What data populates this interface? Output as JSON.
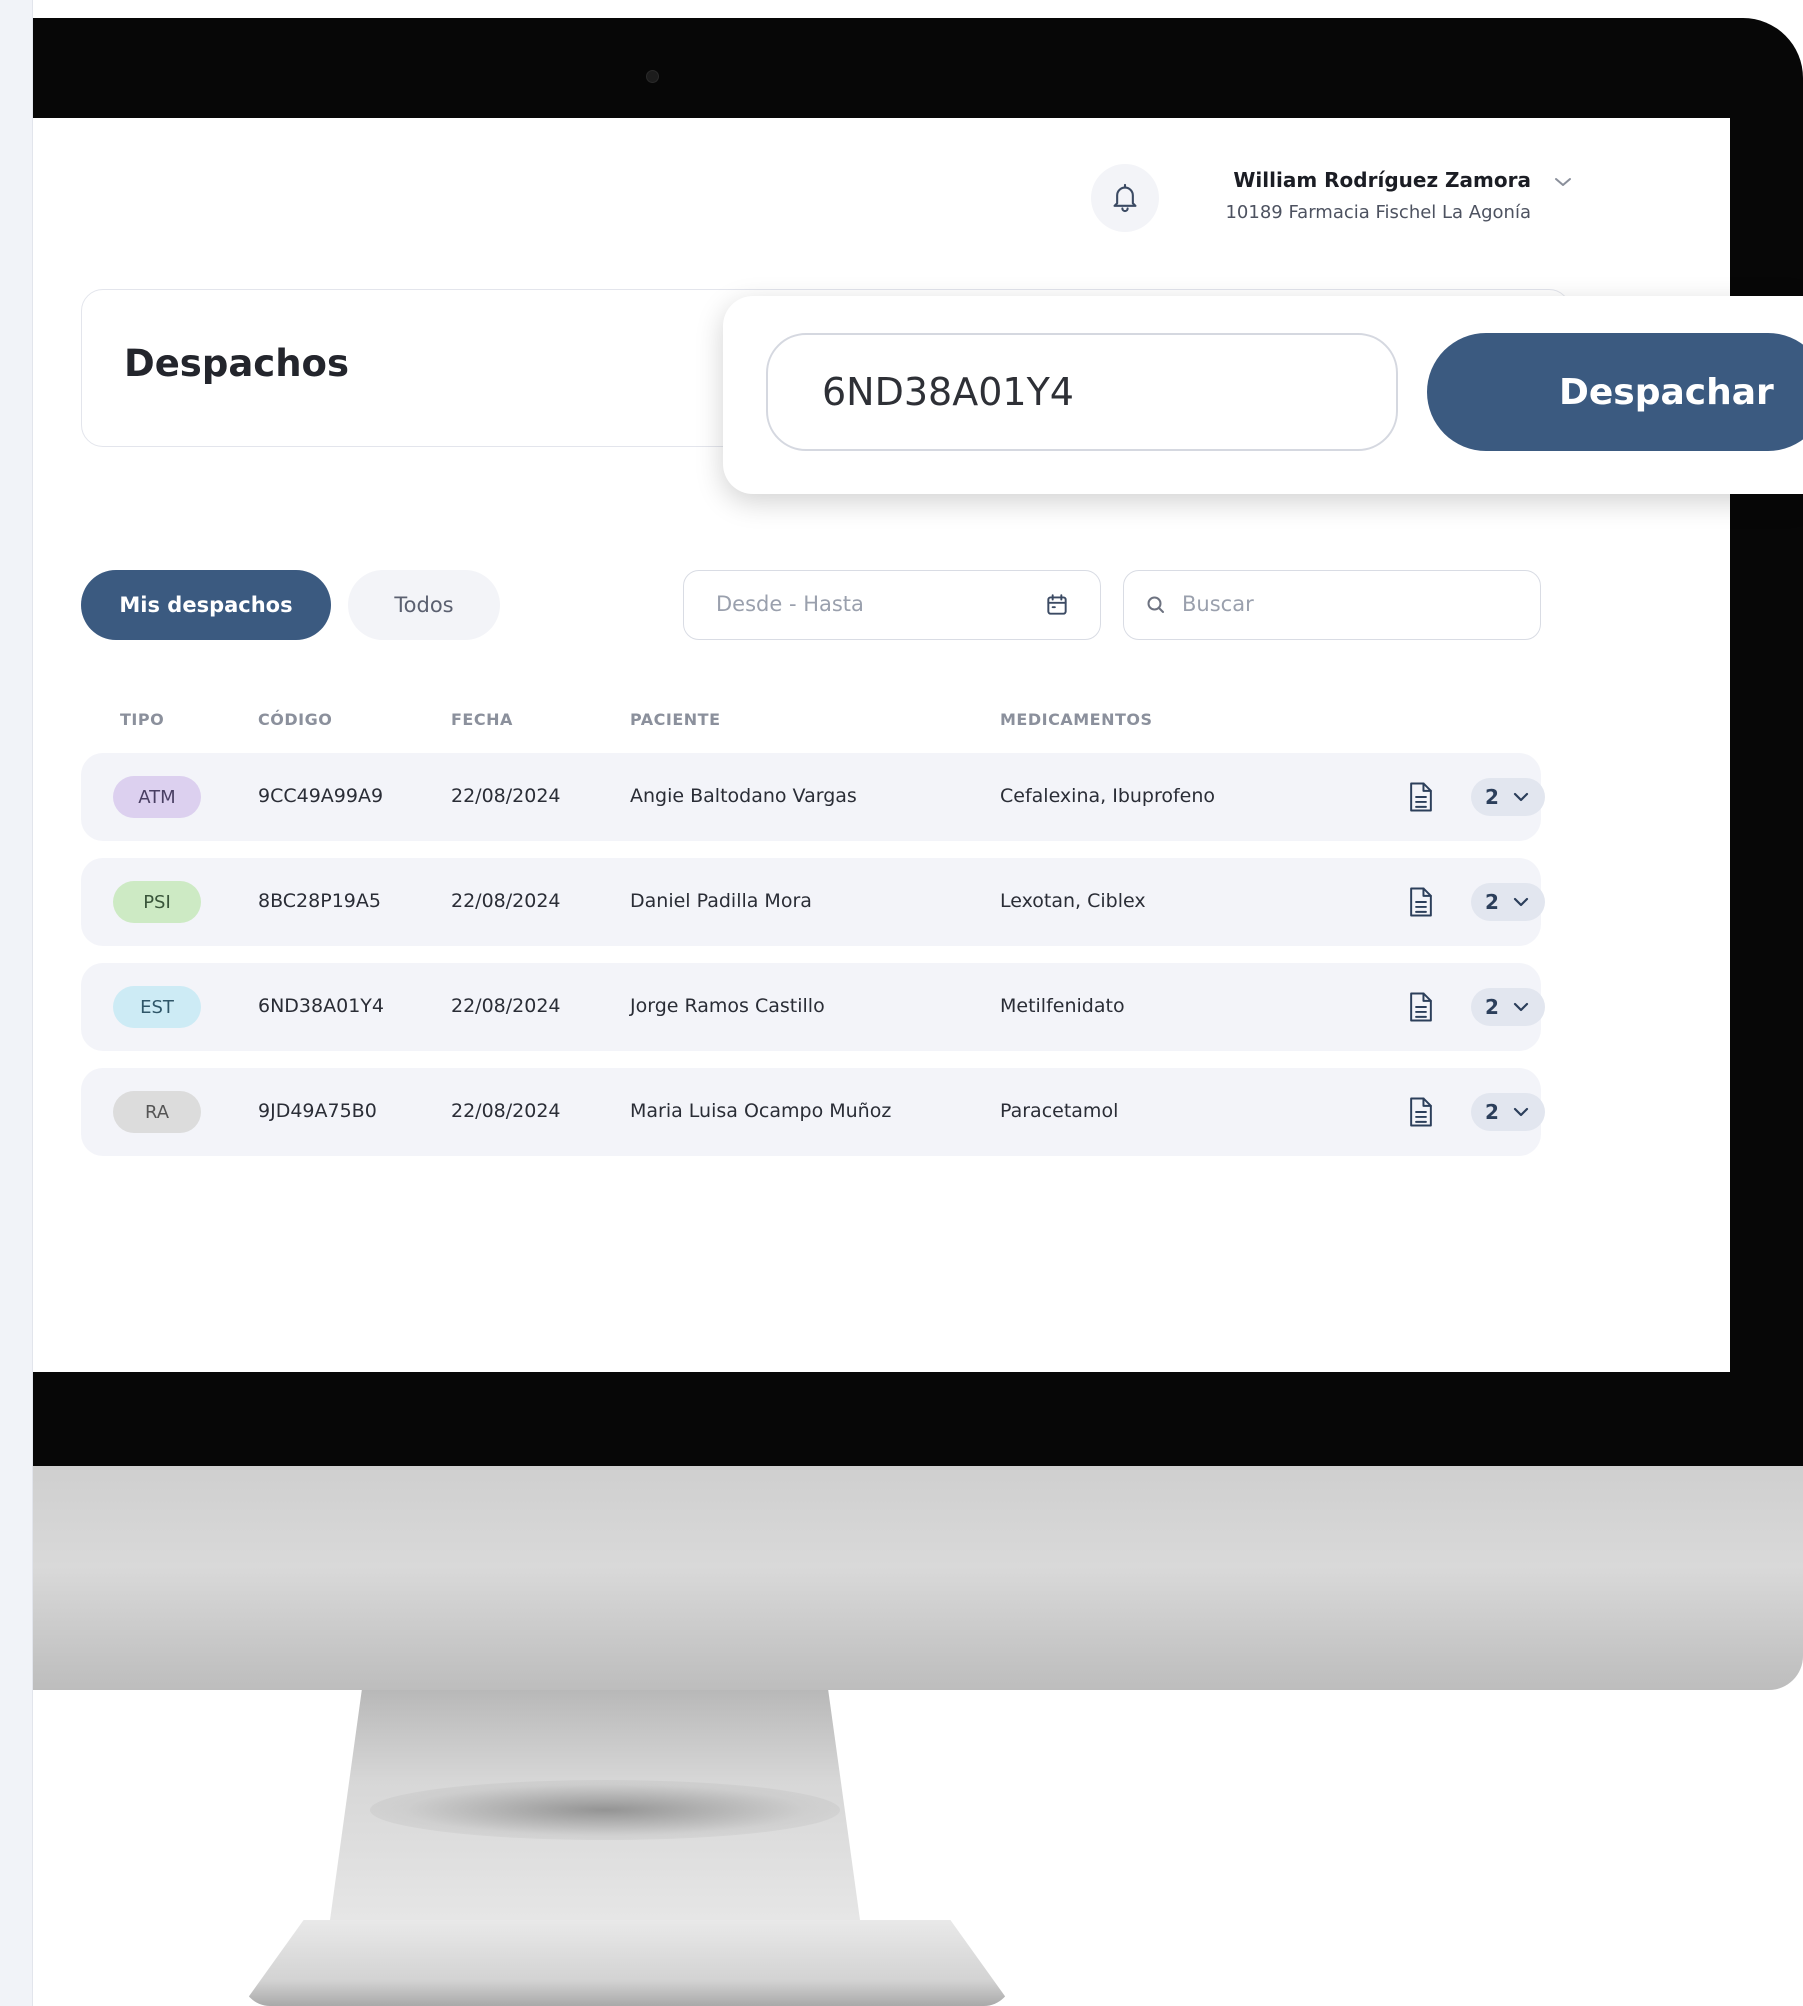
{
  "header": {
    "user_name": "William Rodríguez Zamora",
    "user_branch": "10189 Farmacia Fischel La Agonía",
    "icons": {
      "notifications": "bell-icon",
      "user_menu": "chevron-down-icon"
    }
  },
  "page": {
    "title": "Despachos"
  },
  "dispatch": {
    "code_value": "6ND38A01Y4",
    "button_label": "Despachar"
  },
  "tabs": [
    {
      "label": "Mis despachos",
      "active": true
    },
    {
      "label": "Todos",
      "active": false
    }
  ],
  "filters": {
    "date_placeholder": "Desde - Hasta",
    "date_icon": "calendar-icon",
    "search_placeholder": "Buscar",
    "search_icon": "search-icon"
  },
  "table": {
    "headers": [
      "TIPO",
      "CÓDIGO",
      "FECHA",
      "PACIENTE",
      "MEDICAMENTOS"
    ],
    "rows": [
      {
        "tipo": "ATM",
        "codigo": "9CC49A99A9",
        "fecha": "22/08/2024",
        "paciente": "Angie Baltodano Vargas",
        "medicamentos": "Cefalexina, Ibuprofeno",
        "cantidad": "2"
      },
      {
        "tipo": "PSI",
        "codigo": "8BC28P19A5",
        "fecha": "22/08/2024",
        "paciente": "Daniel Padilla Mora",
        "medicamentos": "Lexotan, Ciblex",
        "cantidad": "2"
      },
      {
        "tipo": "EST",
        "codigo": "6ND38A01Y4",
        "fecha": "22/08/2024",
        "paciente": "Jorge Ramos Castillo",
        "medicamentos": "Metilfenidato",
        "cantidad": "2"
      },
      {
        "tipo": "RA",
        "codigo": "9JD49A75B0",
        "fecha": "22/08/2024",
        "paciente": "Maria Luisa Ocampo Muñoz",
        "medicamentos": "Paracetamol",
        "cantidad": "2"
      }
    ]
  },
  "colors": {
    "primary": "#3b5a80",
    "badge_ATM": "#dcd0ef",
    "badge_ATM_text": "#4a3f63",
    "badge_PSI": "#cdeac4",
    "badge_PSI_text": "#39553a",
    "badge_EST": "#cdebf5",
    "badge_EST_text": "#2f5668",
    "badge_RA": "#dcdcdc",
    "badge_RA_text": "#555555"
  }
}
